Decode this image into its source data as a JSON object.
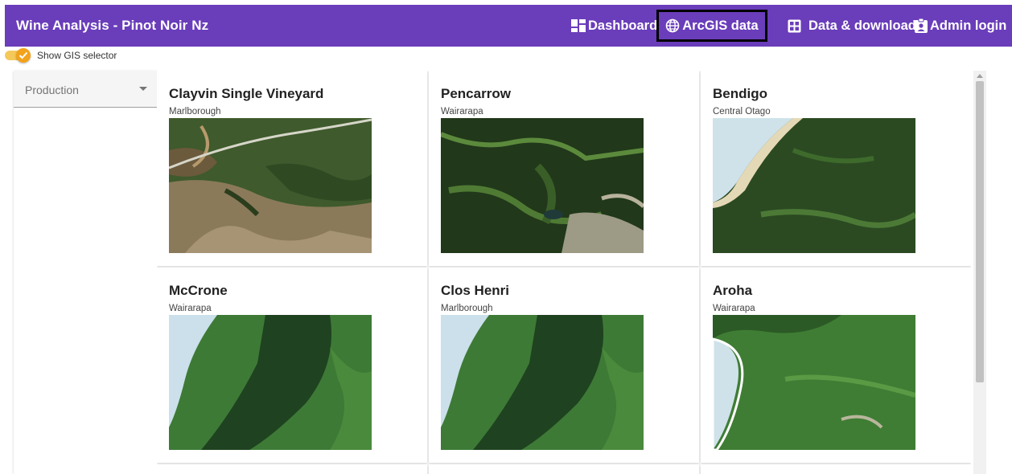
{
  "header": {
    "title": "Wine Analysis - Pinot Noir Nz",
    "nav": [
      {
        "label": "Dashboard",
        "icon": "dashboard-icon"
      },
      {
        "label": "ArcGIS data",
        "icon": "globe-icon"
      },
      {
        "label": "Data & download",
        "icon": "table-icon"
      },
      {
        "label": "Admin login",
        "icon": "badge-icon"
      }
    ],
    "bar_color": "#6a3dba"
  },
  "toggle": {
    "label": "Show GIS selector",
    "checked": true,
    "color": "#f3a21b"
  },
  "sidebar": {
    "select_value": "Production"
  },
  "cards": [
    {
      "title": "Clayvin Single Vineyard",
      "region": "Marlborough",
      "image": "satellite-image"
    },
    {
      "title": "Pencarrow",
      "region": "Wairarapa",
      "image": "satellite-image"
    },
    {
      "title": "Bendigo",
      "region": "Central Otago",
      "image": "satellite-image"
    },
    {
      "title": "McCrone",
      "region": "Wairarapa",
      "image": "satellite-image"
    },
    {
      "title": "Clos Henri",
      "region": "Marlborough",
      "image": "satellite-image"
    },
    {
      "title": "Aroha",
      "region": "Wairarapa",
      "image": "satellite-image"
    }
  ]
}
